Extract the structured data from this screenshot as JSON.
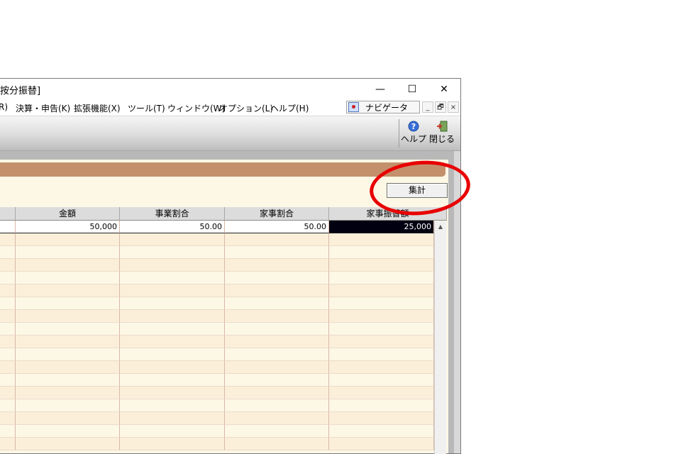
{
  "window": {
    "title": "按分振替]",
    "controls": {
      "minimize": "—",
      "maximize": "☐",
      "close": "✕"
    }
  },
  "menu": {
    "items": [
      {
        "label": "R)"
      },
      {
        "label": "決算・申告(K)"
      },
      {
        "label": "拡張機能(X)"
      },
      {
        "label": "ツール(T)"
      },
      {
        "label": "ウィンドウ(W)"
      },
      {
        "label": "オプション(L)"
      },
      {
        "label": "ヘルプ(H)"
      }
    ],
    "navigator": {
      "label": "ナビゲータ",
      "icon": "navigator-icon"
    },
    "mdi": {
      "minimize": "_",
      "restore": "🗗",
      "close": "×"
    }
  },
  "toolbar": {
    "help_label": "ヘルプ",
    "close_label": "閉じる"
  },
  "actions": {
    "aggregate_label": "集計"
  },
  "table": {
    "columns": [
      "金額",
      "事業割合",
      "家事割合",
      "家事振替額"
    ],
    "first_row": [
      "50,000",
      "50.00",
      "50.00",
      "25,000"
    ]
  },
  "colors": {
    "band": "#c4906c",
    "pane": "#fdf7e6",
    "annotation": "#e80000"
  }
}
